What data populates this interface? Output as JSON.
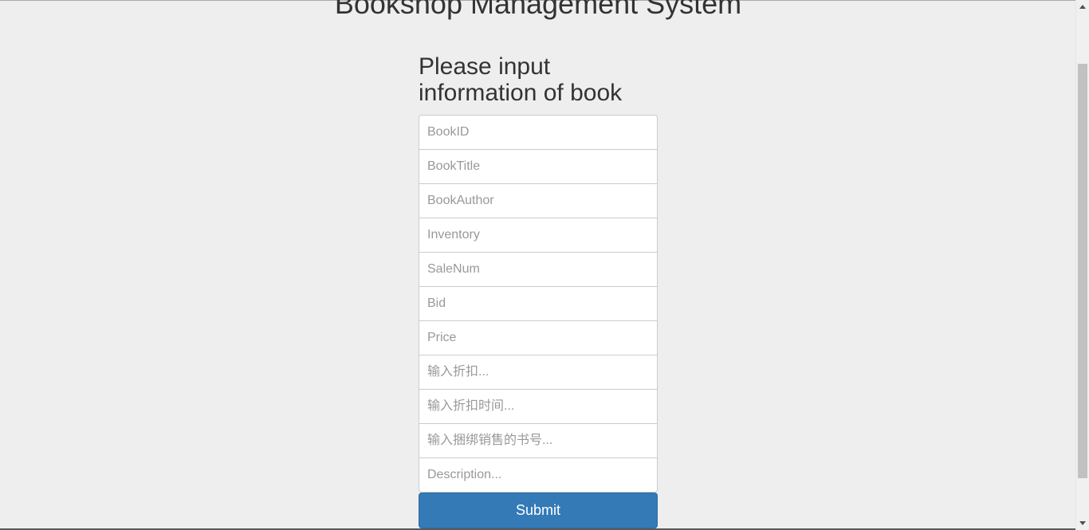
{
  "header": {
    "site_title": "Bookshop Management System"
  },
  "form": {
    "heading": "Please input information of book",
    "fields": {
      "book_id": {
        "placeholder": "BookID",
        "value": ""
      },
      "book_title": {
        "placeholder": "BookTitle",
        "value": ""
      },
      "book_author": {
        "placeholder": "BookAuthor",
        "value": ""
      },
      "inventory": {
        "placeholder": "Inventory",
        "value": ""
      },
      "sale_num": {
        "placeholder": "SaleNum",
        "value": ""
      },
      "bid": {
        "placeholder": "Bid",
        "value": ""
      },
      "price": {
        "placeholder": "Price",
        "value": ""
      },
      "discount": {
        "placeholder": "输入折扣...",
        "value": ""
      },
      "discount_time": {
        "placeholder": "输入折扣时间...",
        "value": ""
      },
      "bundle_book_id": {
        "placeholder": "输入捆绑销售的书号...",
        "value": ""
      },
      "description": {
        "placeholder": "Description...",
        "value": ""
      }
    },
    "submit_label": "Submit"
  },
  "scrollbar": {
    "up_icon": "arrow-up-icon",
    "down_icon": "arrow-down-icon"
  },
  "colors": {
    "background": "#eeeeee",
    "primary_button": "#337ab7",
    "input_border": "#cccccc",
    "text": "#333333"
  }
}
